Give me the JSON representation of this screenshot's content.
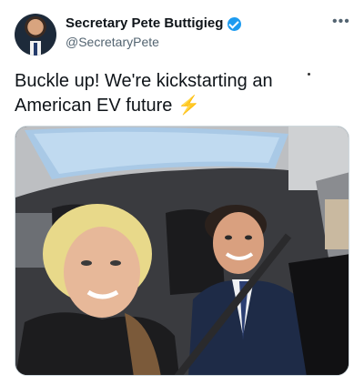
{
  "tweet": {
    "author_name": "Secretary Pete Buttigieg",
    "author_handle": "@SecretaryPete",
    "verified": true,
    "text": "Buckle up! We're kickstarting an American EV future",
    "emoji": "⚡",
    "more_label": "•••"
  },
  "icons": {
    "verified": "verified-badge-icon",
    "more": "more-options-icon",
    "emoji": "high-voltage-emoji"
  },
  "colors": {
    "verified_blue": "#1d9bf0",
    "handle_gray": "#536471",
    "bolt_yellow": "#f5a623"
  }
}
